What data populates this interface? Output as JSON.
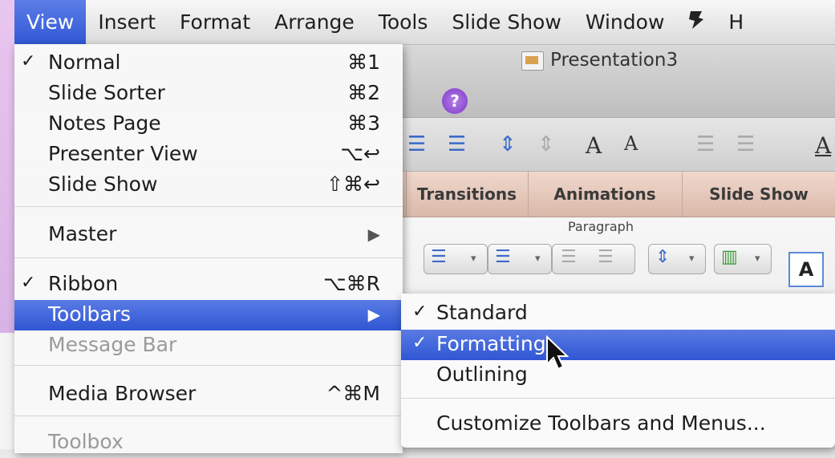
{
  "menubar": {
    "items": [
      "View",
      "Insert",
      "Format",
      "Arrange",
      "Tools",
      "Slide Show",
      "Window",
      "H"
    ],
    "script_icon": "script-menu-icon",
    "active_index": 0
  },
  "window": {
    "title": "Presentation3",
    "help_label": "?"
  },
  "ribbon_tabs": [
    "Transitions",
    "Animations",
    "Slide Show"
  ],
  "ribbon": {
    "group_label": "Paragraph",
    "text_box_glyph": "A"
  },
  "toolbar_glyphs": {
    "a_large": "A",
    "a_small": "A",
    "a_last": "A"
  },
  "view_menu": {
    "items": [
      {
        "label": "Normal",
        "checked": true,
        "shortcut": "⌘1"
      },
      {
        "label": "Slide Sorter",
        "checked": false,
        "shortcut": "⌘2"
      },
      {
        "label": "Notes Page",
        "checked": false,
        "shortcut": "⌘3"
      },
      {
        "label": "Presenter View",
        "checked": false,
        "shortcut": "⌥↩"
      },
      {
        "label": "Slide Show",
        "checked": false,
        "shortcut": "⇧⌘↩"
      },
      {
        "label": "Master",
        "checked": false,
        "submenu": true
      },
      {
        "label": "Ribbon",
        "checked": true,
        "shortcut": "⌥⌘R"
      },
      {
        "label": "Toolbars",
        "checked": false,
        "submenu": true,
        "highlighted": true
      },
      {
        "label": "Message Bar",
        "checked": false,
        "disabled": true
      },
      {
        "label": "Media Browser",
        "checked": false,
        "shortcut": "^⌘M"
      },
      {
        "label": "Toolbox",
        "checked": false,
        "disabled": true
      }
    ],
    "check_mark": "✓",
    "submenu_arrow": "▶"
  },
  "toolbars_submenu": {
    "items": [
      {
        "label": "Standard",
        "checked": true
      },
      {
        "label": "Formatting",
        "checked": true,
        "highlighted": true
      },
      {
        "label": "Outlining",
        "checked": false
      },
      {
        "label": "Customize Toolbars and Menus...",
        "checked": false
      }
    ]
  }
}
